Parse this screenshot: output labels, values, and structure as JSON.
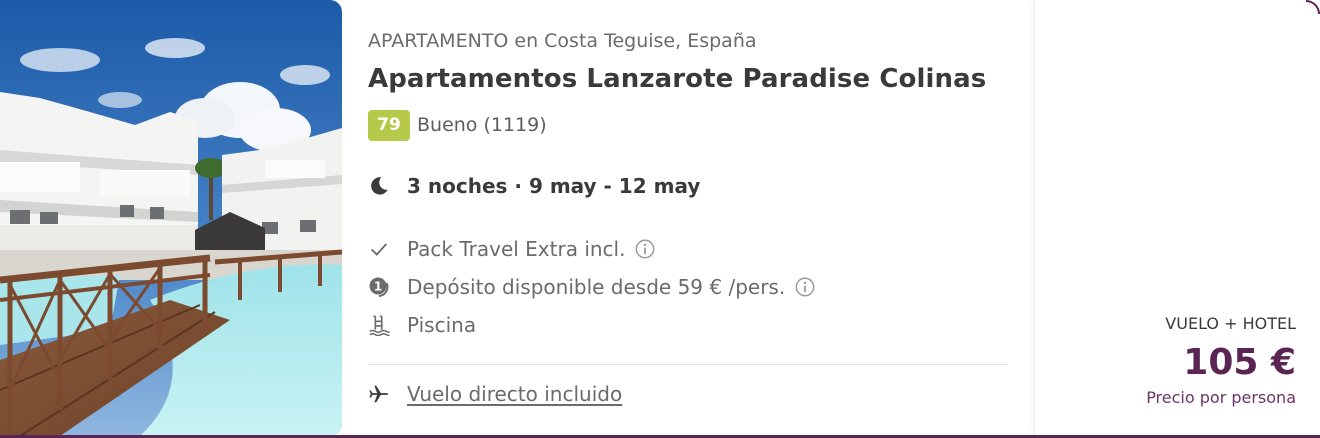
{
  "hotel": {
    "type_location": "APARTAMENTO en Costa Teguise, España",
    "name": "Apartamentos Lanzarote Paradise Colinas",
    "score": "79",
    "rating_text": "Bueno (1119)",
    "stay": "3 noches · 9 may - 12 may"
  },
  "features": [
    {
      "icon": "check-icon",
      "label": "Pack Travel Extra incl.",
      "info": true
    },
    {
      "icon": "deposit-icon",
      "label": "Depósito disponible desde 59 € /pers.",
      "info": true
    },
    {
      "icon": "pool-icon",
      "label": "Piscina",
      "info": false
    }
  ],
  "flight": {
    "icon": "plane-icon",
    "label": "Vuelo directo incluido"
  },
  "price": {
    "pack_label": "VUELO + HOTEL",
    "amount": "105 €",
    "note": "Precio por persona"
  },
  "colors": {
    "accent": "#5a2553",
    "score_badge": "#b6c94a"
  }
}
